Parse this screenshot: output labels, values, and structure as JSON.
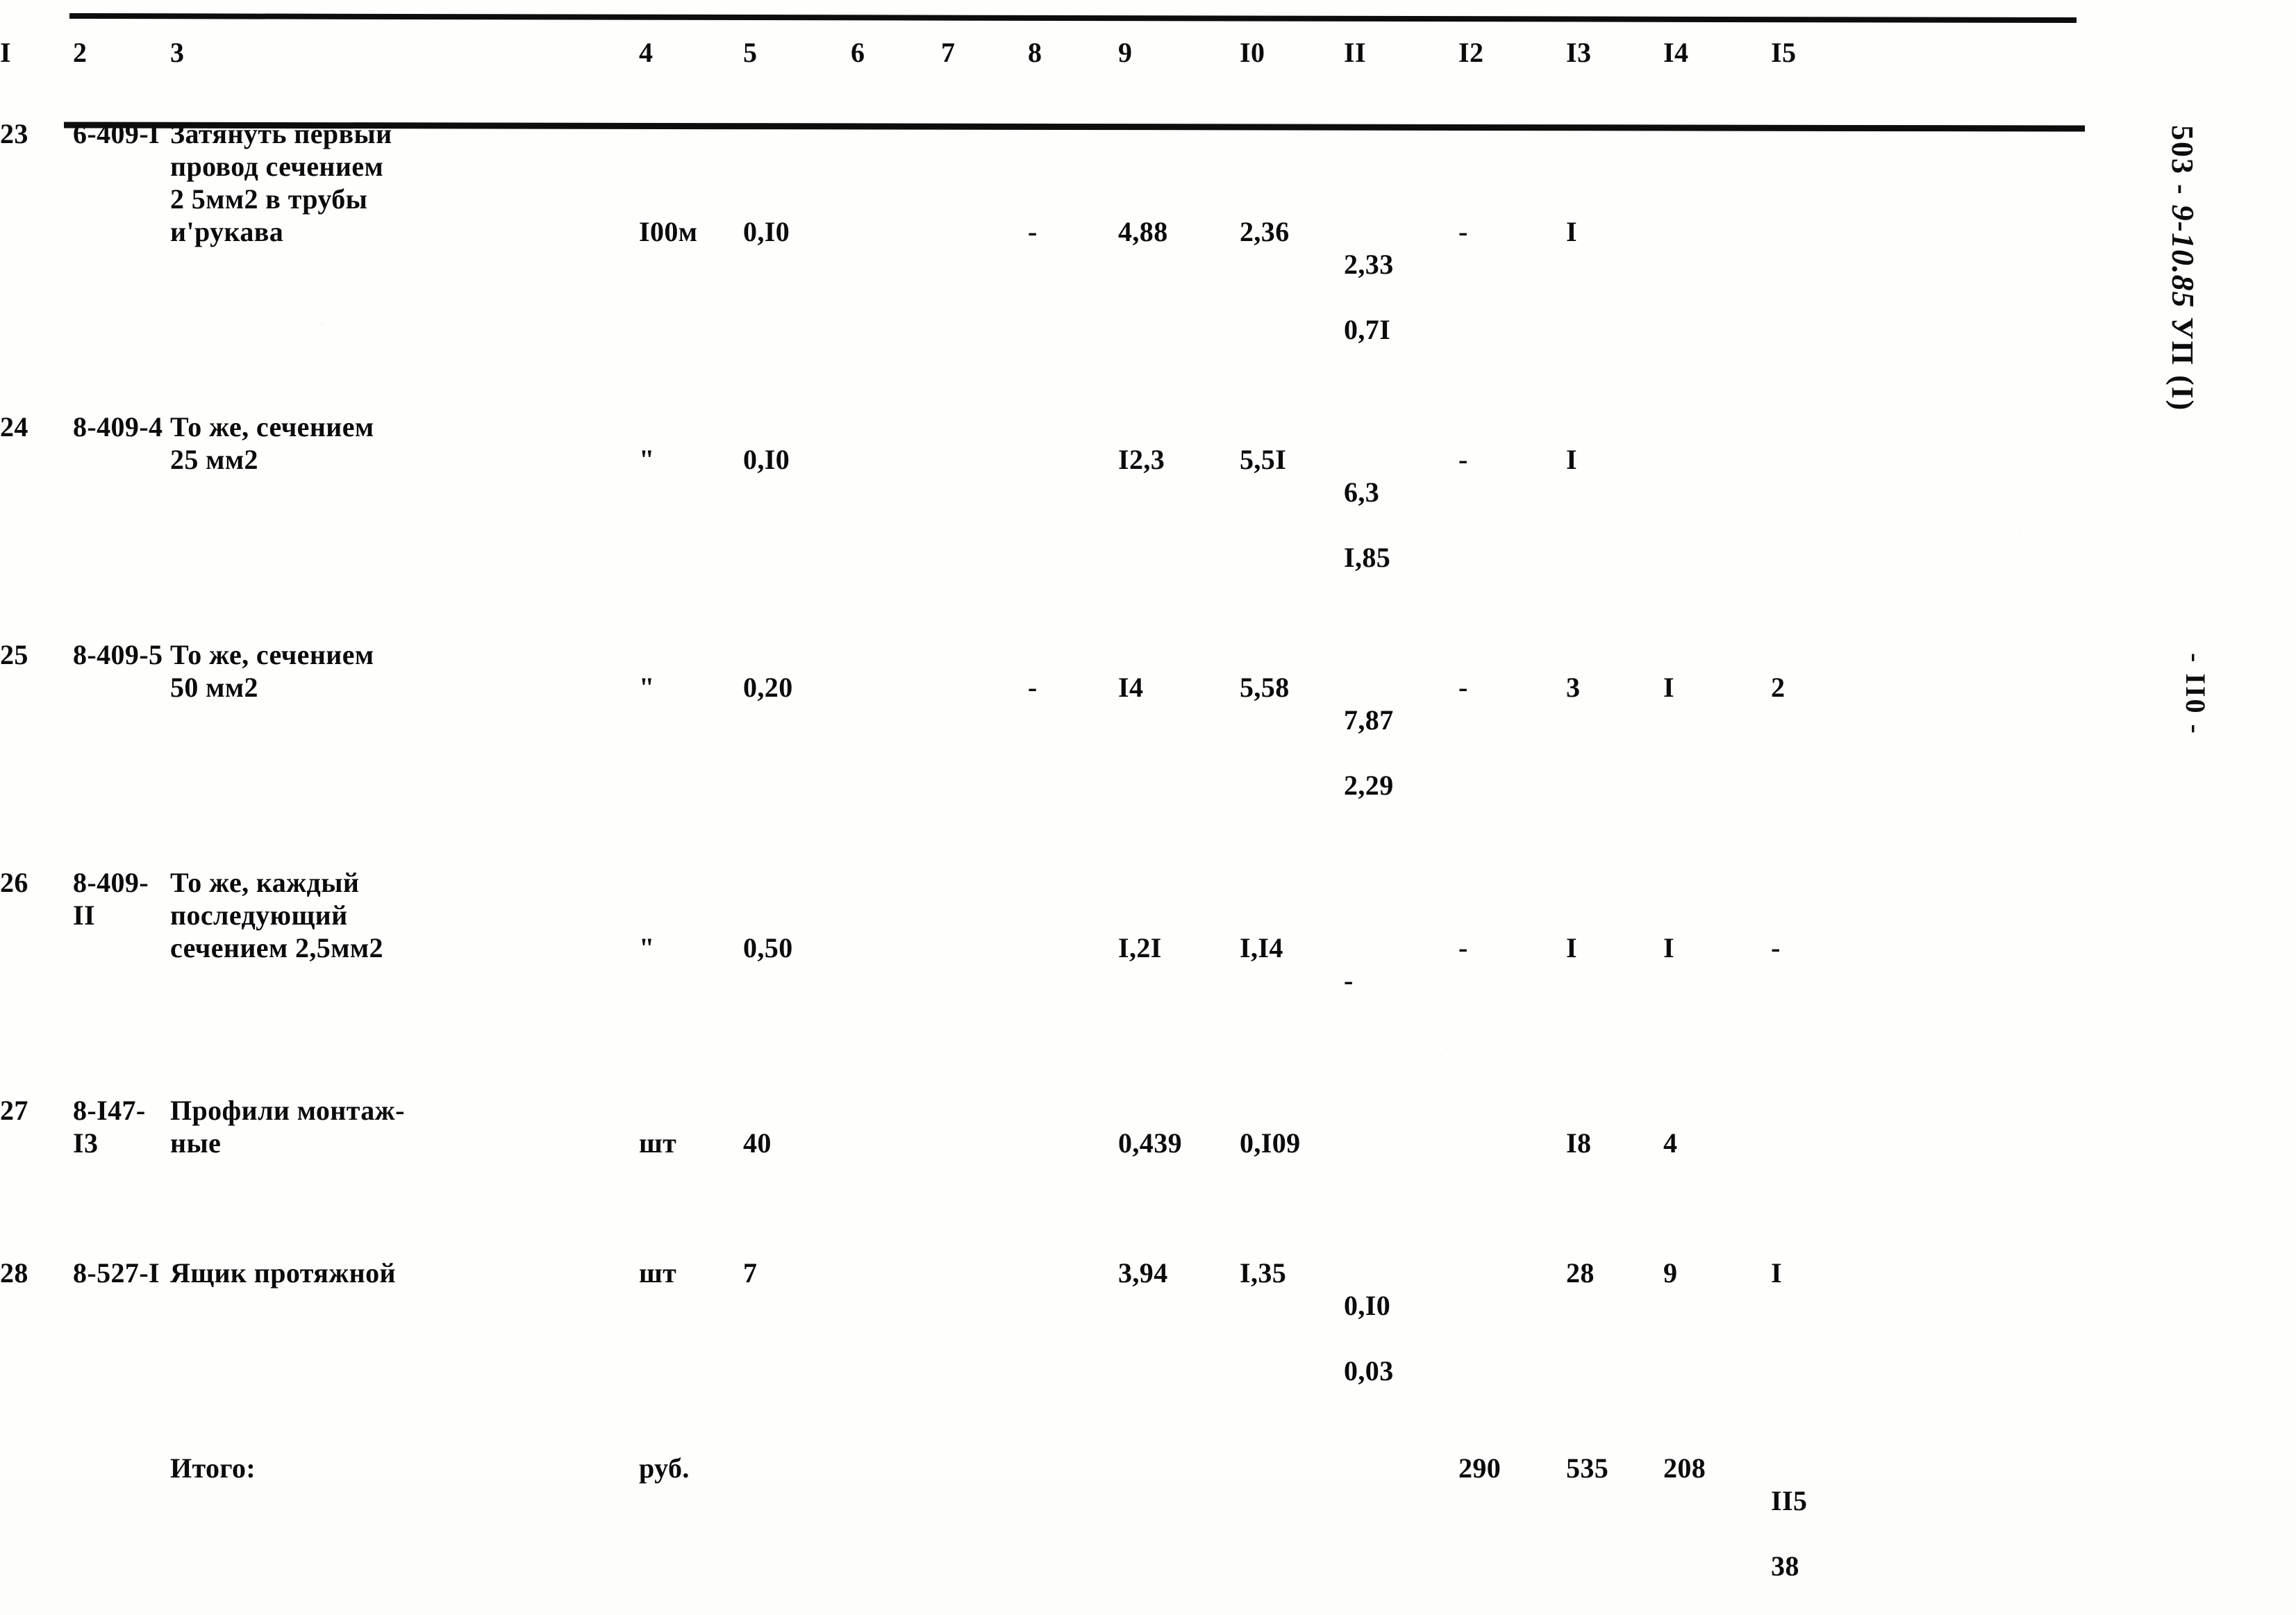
{
  "document": {
    "kind": "scanned-estimate-table",
    "margin_notes": {
      "code_prefix": "503 - ",
      "code_italic": "9-10.85",
      "code_suffix": " УП (I)",
      "page_number": "- II0 -"
    }
  },
  "table": {
    "column_headers": [
      "I",
      "2",
      "3",
      "4",
      "5",
      "6",
      "7",
      "8",
      "9",
      "I0",
      "II",
      "I2",
      "I3",
      "I4",
      "I5"
    ],
    "rows": [
      {
        "c1": "23",
        "c2": "6-409-I",
        "c3": "Затянуть первый\nпровод сечением\n2 5мм2 в трубы\nи'рукава",
        "c4": "I00м",
        "c5": "0,I0",
        "c6": "",
        "c7": "",
        "c8": "-",
        "c9": "4,88",
        "c10": "2,36",
        "c11_top": "2,33",
        "c11_bottom": "0,7I",
        "c12": "-",
        "c13": "I",
        "c14": "",
        "c15": ""
      },
      {
        "c1": "24",
        "c2": "8-409-4",
        "c3": "То же, сечением\n25 мм2",
        "c4": "\"",
        "c5": "0,I0",
        "c6": "",
        "c7": "",
        "c8": "",
        "c9": "I2,3",
        "c10": "5,5I",
        "c11_top": "6,3",
        "c11_bottom": "I,85",
        "c12": "-",
        "c13": "I",
        "c14": "",
        "c15": ""
      },
      {
        "c1": "25",
        "c2": "8-409-5",
        "c3": "То же, сечением\n50 мм2",
        "c4": "\"",
        "c5": "0,20",
        "c6": "",
        "c7": "",
        "c8": "-",
        "c9": "I4",
        "c10": "5,58",
        "c11_top": "7,87",
        "c11_bottom": "2,29",
        "c12": "-",
        "c13": "3",
        "c14": "I",
        "c15": "2"
      },
      {
        "c1": "26",
        "c2": "8-409-II",
        "c3": "То же, каждый\nпоследующий\nсечением 2,5мм2",
        "c4": "\"",
        "c5": "0,50",
        "c6": "",
        "c7": "",
        "c8": "",
        "c9": "I,2I",
        "c10": "I,I4",
        "c11_top": "-",
        "c11_bottom": "",
        "c12": "-",
        "c13": "I",
        "c14": "I",
        "c15": "-"
      },
      {
        "c1": "27",
        "c2": "8-I47-I3",
        "c3": "Профили монтаж-\nные",
        "c4": "шт",
        "c5": "40",
        "c6": "",
        "c7": "",
        "c8": "",
        "c9": "0,439",
        "c10": "0,I09",
        "c11_top": "",
        "c11_bottom": "",
        "c12": "",
        "c13": "I8",
        "c14": "4",
        "c15": ""
      },
      {
        "c1": "28",
        "c2": "8-527-I",
        "c3": "Ящик протяжной",
        "c4": "шт",
        "c5": "7",
        "c6": "",
        "c7": "",
        "c8": "",
        "c9": "3,94",
        "c10": "I,35",
        "c11_top": "0,I0",
        "c11_bottom": "0,03",
        "c12": "",
        "c13": "28",
        "c14": "9",
        "c15": "I"
      }
    ],
    "total_row": {
      "label": "Итого:",
      "unit": "руб.",
      "c12": "290",
      "c13": "535",
      "c14": "208",
      "c15_top": "II5",
      "c15_bottom": "38"
    }
  }
}
